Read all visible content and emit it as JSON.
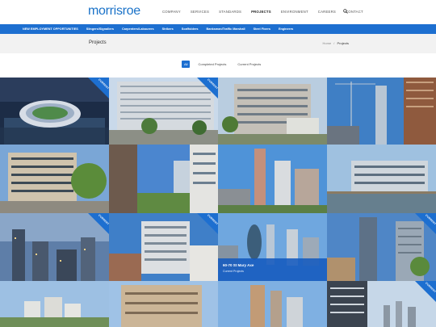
{
  "brand": {
    "logo": "morrisroe"
  },
  "nav": {
    "items": [
      "COMPANY",
      "SERVICES",
      "STANDARDS",
      "PROJECTS",
      "ENVIRONMENT",
      "CAREERS",
      "CONTACT"
    ],
    "active_index": 3
  },
  "jobs_bar": {
    "items": [
      "NEW EMPLOYMENT OPPORTUNITIES",
      "Slingers/Signallers",
      "Carpenters/Labourers",
      "Strikers",
      "Scaffolders",
      "Banksman/Traffic Marshall",
      "Steel Fixers",
      "Engineers"
    ]
  },
  "page": {
    "title": "Projects",
    "breadcrumb": [
      "Home",
      "/",
      "Projects"
    ]
  },
  "filters": {
    "items": [
      "All",
      "Completed Projects",
      "Current Projects"
    ],
    "active_index": 0
  },
  "ribbon_text": "CURRENT",
  "featured": {
    "title": "60-70 St Mary Axe",
    "subtitle": "Current Projects"
  },
  "colors": {
    "brand_blue": "#1d6fd0",
    "logo_blue": "#1a72c8"
  }
}
